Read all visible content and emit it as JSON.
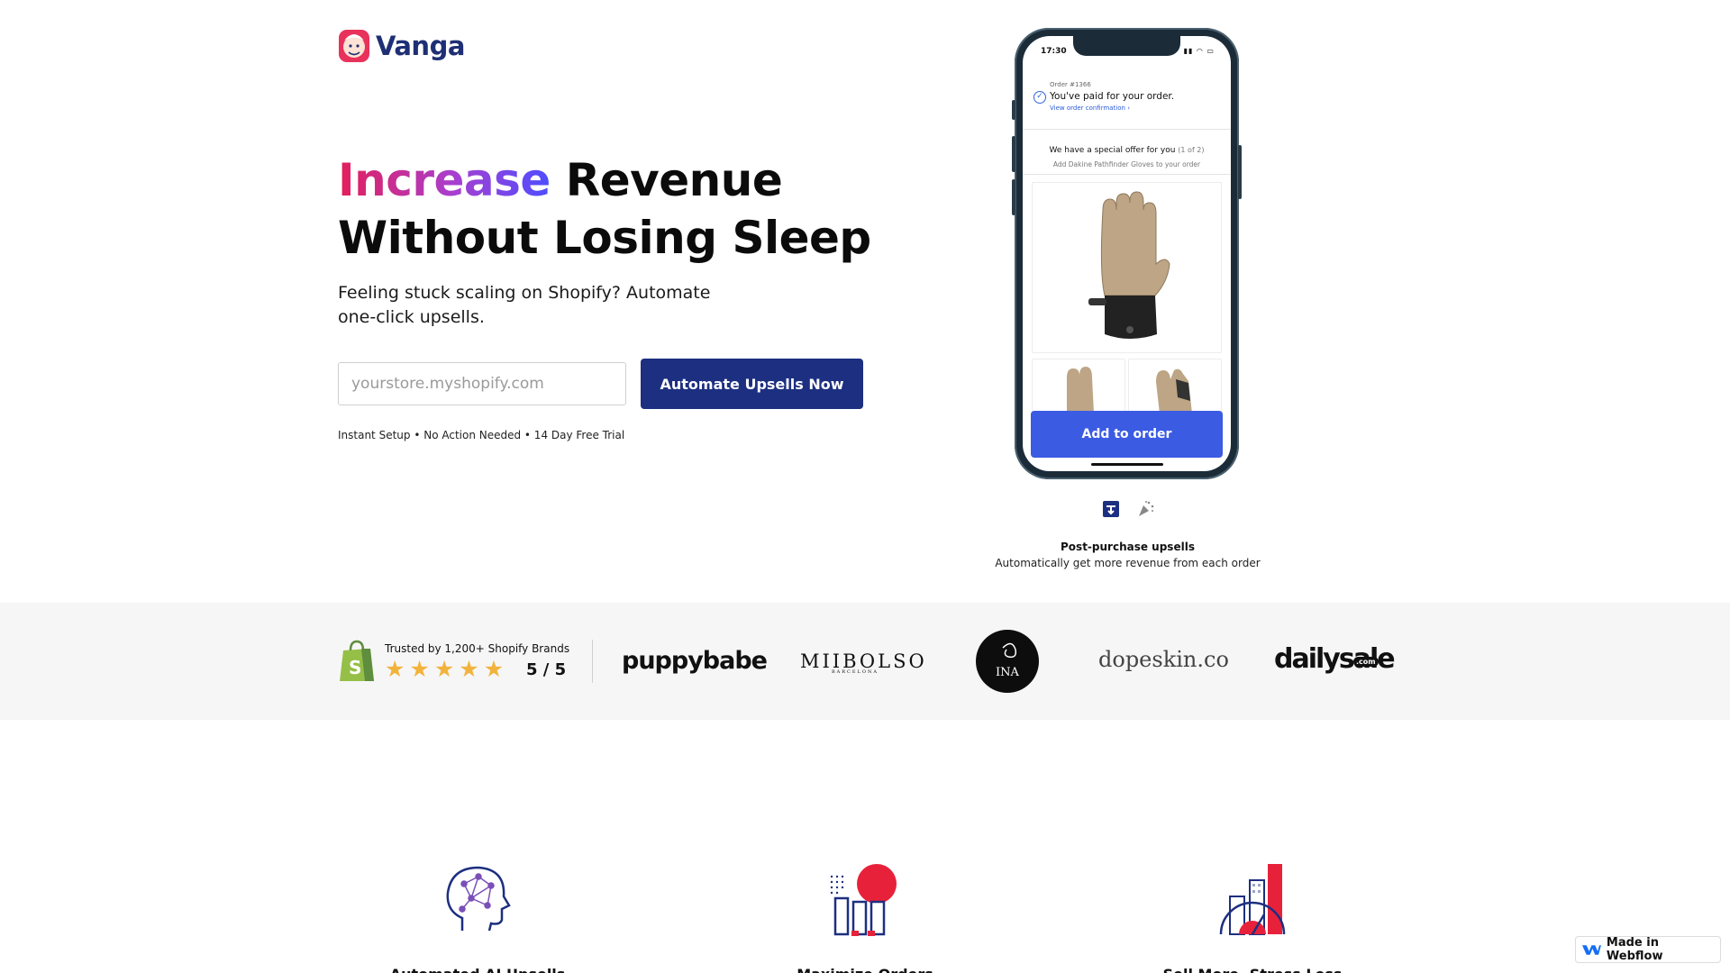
{
  "header": {
    "logo_text": "Vanga"
  },
  "hero": {
    "title_highlight": "Increase",
    "title_rest_line1": "Revenue",
    "title_line2": "Without Losing Sleep",
    "subtitle": "Feeling stuck scaling on Shopify? Automate one-click upsells.",
    "store_input_placeholder": "yourstore.myshopify.com",
    "cta_label": "Automate Upsells Now",
    "setup_note": "Instant Setup • No Action Needed • 14 Day Free Trial"
  },
  "phone": {
    "status_time": "17:30",
    "order_number": "Order #1366",
    "order_paid": "You've paid for your order.",
    "order_link": "View order confirmation ›",
    "offer_title": "We have a special offer for you",
    "offer_count": "(1 of 2)",
    "offer_sub": "Add Dakine Pathfinder Gloves to your order",
    "add_button": "Add to order"
  },
  "feature": {
    "title": "Post-purchase upsells",
    "subtitle": "Automatically get more revenue from each order"
  },
  "trust": {
    "trusted_text": "Trusted by 1,200+ Shopify Brands",
    "rating": "5 / 5",
    "stars": 5,
    "brands": [
      "puppybabe",
      "MIIBOLSO",
      "BARCELONA",
      "INA",
      "dopeskin.co",
      "dailysale",
      ".com"
    ]
  },
  "benefits": [
    {
      "label": "Automated AI Upsells",
      "icon": "brain-icon"
    },
    {
      "label": "Maximize Orders",
      "icon": "shopping-icon"
    },
    {
      "label": "Sell More, Stress Less",
      "icon": "growth-chart-icon"
    }
  ],
  "badge": {
    "label": "Made in Webflow"
  },
  "colors": {
    "brand_navy": "#1d2f80",
    "button_blue": "#3b5be3",
    "star": "#f2b33d",
    "shopify_green": "#95bf47"
  }
}
